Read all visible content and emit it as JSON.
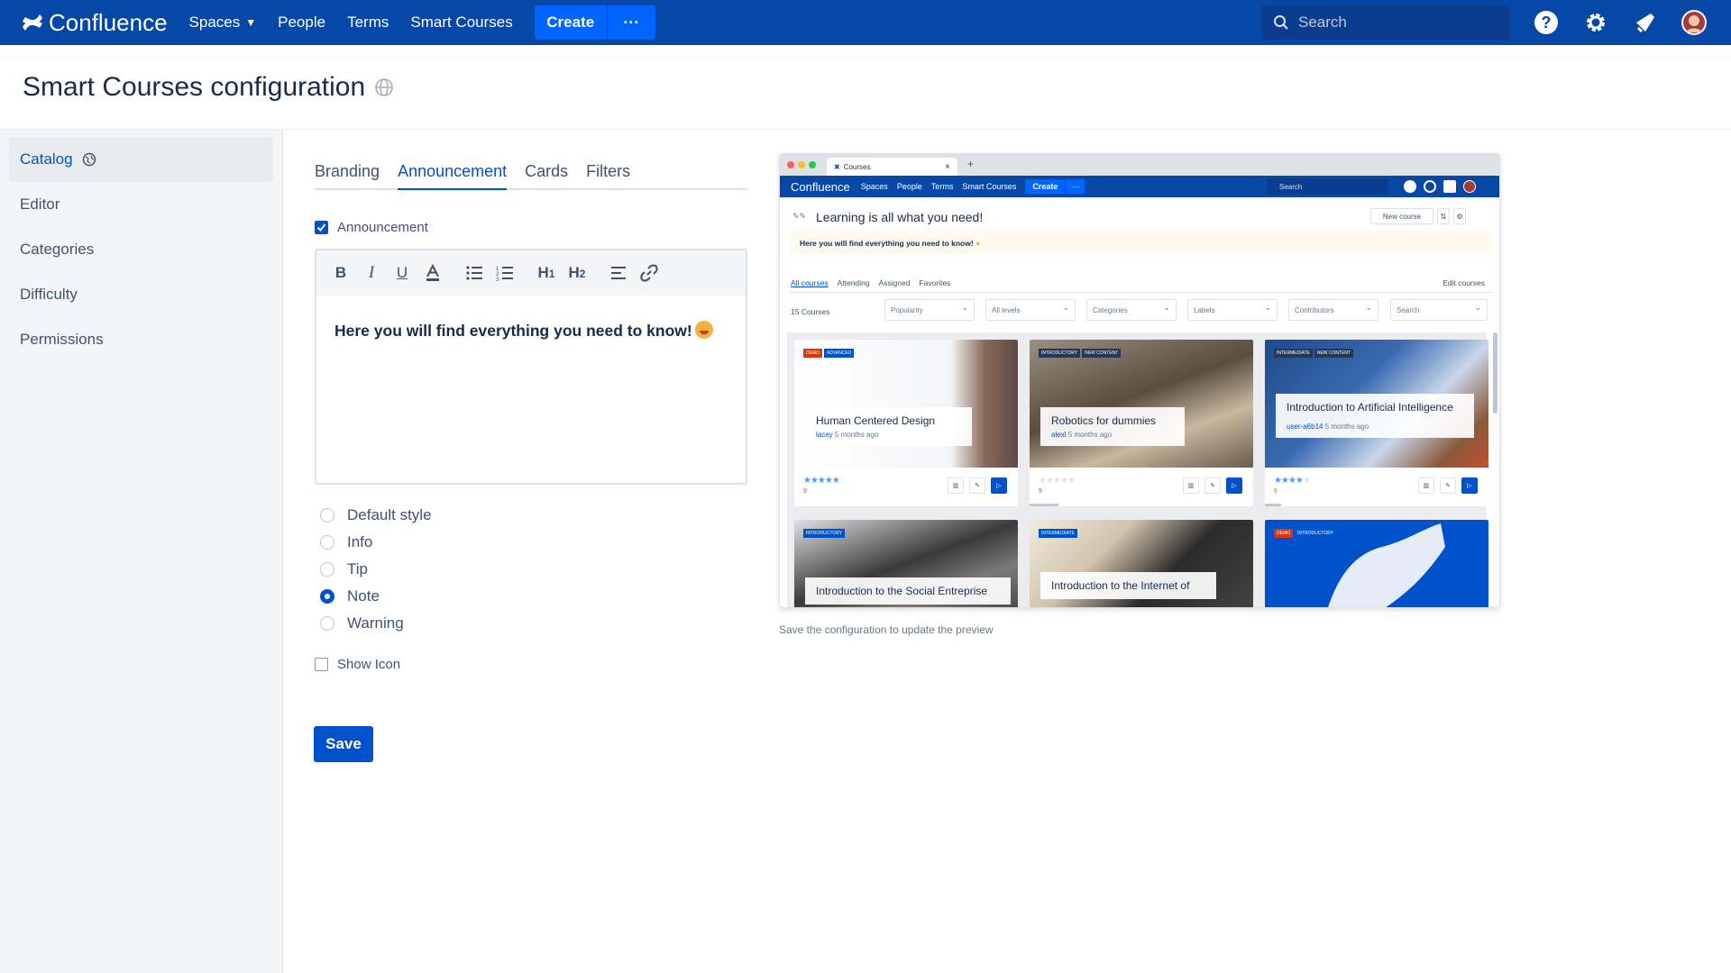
{
  "topnav": {
    "logo": "Confluence",
    "items": [
      "Spaces",
      "People",
      "Terms",
      "Smart Courses"
    ],
    "create_label": "Create",
    "more_label": "···",
    "search_placeholder": "Search",
    "brand_color": "#0747a6"
  },
  "page": {
    "title": "Smart Courses configuration"
  },
  "sidebar": {
    "items": [
      {
        "label": "Catalog",
        "active": true
      },
      {
        "label": "Editor"
      },
      {
        "label": "Categories"
      },
      {
        "label": "Difficulty"
      },
      {
        "label": "Permissions"
      }
    ]
  },
  "tabs": [
    "Branding",
    "Announcement",
    "Cards",
    "Filters"
  ],
  "active_tab": "Announcement",
  "announcement": {
    "checkbox_label": "Announcement",
    "checked": true,
    "editor_text": "Here you will find everything you need to know!",
    "toolbar": [
      "bold-icon",
      "italic-icon",
      "underline-icon",
      "text-color-icon",
      "bullet-list-icon",
      "numbered-list-icon",
      "heading-1-icon",
      "heading-2-icon",
      "align-icon",
      "link-icon"
    ]
  },
  "style_options": [
    {
      "label": "Default style",
      "checked": false
    },
    {
      "label": "Info",
      "checked": false
    },
    {
      "label": "Tip",
      "checked": false
    },
    {
      "label": "Note",
      "checked": true
    },
    {
      "label": "Warning",
      "checked": false
    }
  ],
  "show_icon": {
    "label": "Show Icon",
    "checked": false
  },
  "save_label": "Save",
  "preview": {
    "browser_tab": "Courses",
    "nav": {
      "logo": "Confluence",
      "items": [
        "Spaces",
        "People",
        "Terms",
        "Smart Courses"
      ],
      "create": "Create",
      "more": "···",
      "search": "Search"
    },
    "heading": "Learning is all what you need!",
    "new_course": "New course",
    "announcement": "Here you will find everything you need to know!",
    "tabs": [
      "All courses",
      "Attending",
      "Assigned",
      "Favorites"
    ],
    "edit_courses": "Edit courses",
    "count": "15 Courses",
    "filters": [
      "Popularity",
      "All levels",
      "Categories",
      "Labels",
      "Contributors"
    ],
    "search": "Search",
    "cards": [
      {
        "title": "Human Centered Design",
        "user": "lacey",
        "time": "5 months ago",
        "rating": "9",
        "tags": [
          "DEMO",
          "ADVANCED"
        ]
      },
      {
        "title": "Robotics for dummies",
        "user": "alexl",
        "time": "5 months ago",
        "rating": "9",
        "tags": [
          "INTRODUCTORY",
          "NEW CONTENT"
        ]
      },
      {
        "title": "Introduction to Artificial Intelligence",
        "user": "user-a6b14",
        "time": "5 months ago",
        "rating": "6",
        "tags": [
          "INTERMEDIATE",
          "NEW CONTENT"
        ]
      },
      {
        "title": "Introduction to the Social Entreprise",
        "tags": [
          "INTRODUCTORY"
        ]
      },
      {
        "title": "Introduction to the Internet of",
        "tags": [
          "INTERMEDIATE"
        ]
      },
      {
        "title": "",
        "tags": [
          "DEMO",
          "INTRODUCTORY"
        ]
      }
    ],
    "caption": "Save the configuration to update the preview"
  }
}
